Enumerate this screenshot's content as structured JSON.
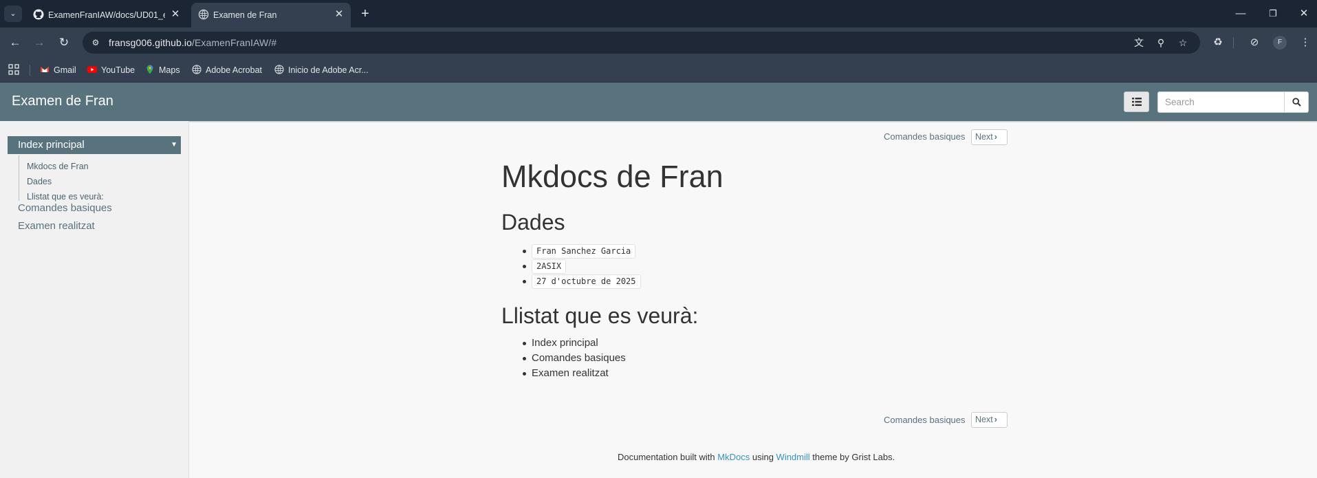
{
  "browser": {
    "tabs": [
      {
        "title": "ExamenFranIAW/docs/UD01_ex",
        "favicon": "github-icon",
        "active": false
      },
      {
        "title": "Examen de Fran",
        "favicon": "globe-icon",
        "active": true
      }
    ],
    "url": {
      "host": "fransg006.github.io",
      "path": "/ExamenFranIAW/#"
    },
    "profile_initial": "F",
    "bookmarks": [
      {
        "label": "Gmail",
        "icon": "gmail-icon"
      },
      {
        "label": "YouTube",
        "icon": "youtube-icon"
      },
      {
        "label": "Maps",
        "icon": "maps-icon"
      },
      {
        "label": "Adobe Acrobat",
        "icon": "globe-icon"
      },
      {
        "label": "Inicio de Adobe Acr...",
        "icon": "globe-icon"
      }
    ]
  },
  "site": {
    "brand": "Examen de Fran",
    "search_placeholder": "Search"
  },
  "sidebar": {
    "active": "Index principal",
    "subitems": [
      "Mkdocs de Fran",
      "Dades",
      "Llistat que es veurà:"
    ],
    "links": [
      "Comandes basiques",
      "Examen realitzat"
    ]
  },
  "pager": {
    "next_title": "Comandes basiques",
    "next_label": "Next"
  },
  "content": {
    "h1": "Mkdocs de Fran",
    "dades_heading": "Dades",
    "dades": [
      "Fran Sanchez Garcia",
      "2ASIX",
      "27 d'octubre de 2025"
    ],
    "llistat_heading": "Llistat que es veurà:",
    "llistat": [
      "Index principal",
      "Comandes basiques",
      "Examen realitzat"
    ]
  },
  "footer": {
    "prefix": "Documentation built with",
    "mkdocs": "MkDocs",
    "using": "using",
    "windmill": "Windmill",
    "suffix": "theme by Grist Labs."
  },
  "colors": {
    "navbar": "#58727e",
    "link": "#3592c4",
    "chrome_dark": "#1b2533",
    "chrome": "#34404f"
  }
}
